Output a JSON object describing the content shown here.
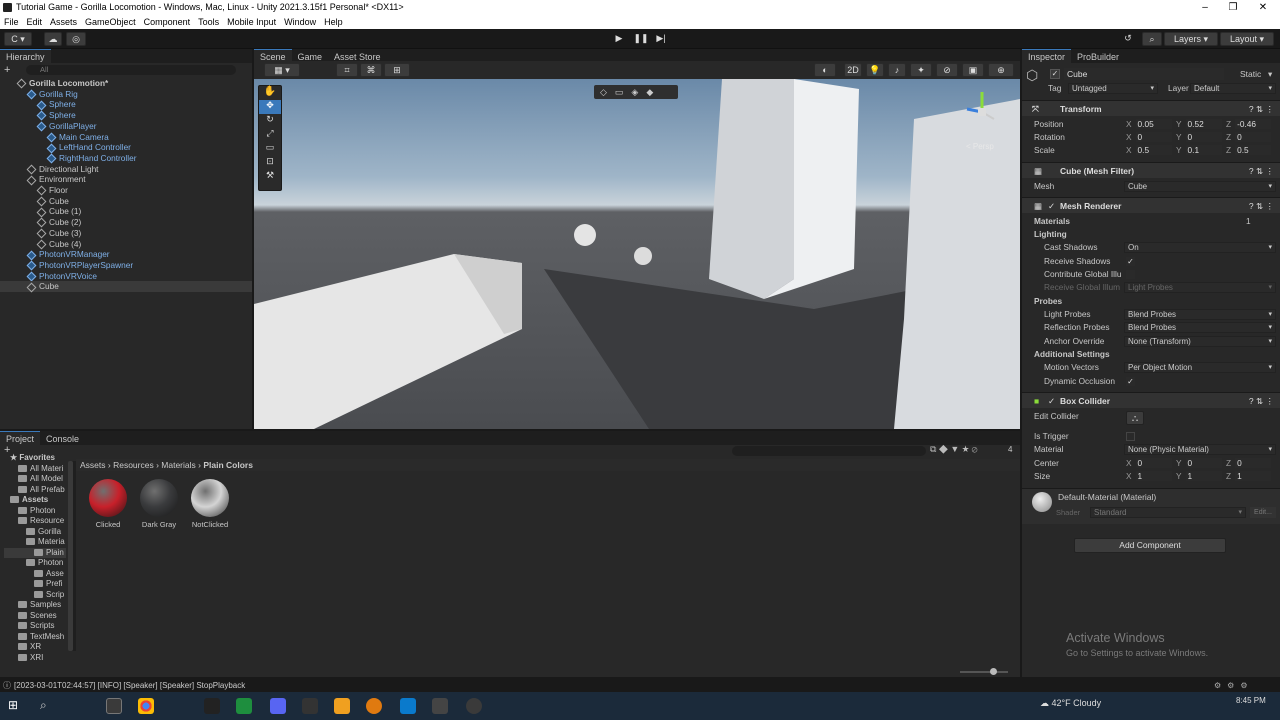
{
  "window": {
    "title": "Tutorial Game - Gorilla Locomotion - Windows, Mac, Linux - Unity 2021.3.15f1 Personal* <DX11>"
  },
  "menu": [
    "File",
    "Edit",
    "Assets",
    "GameObject",
    "Component",
    "Tools",
    "Mobile Input",
    "Window",
    "Help"
  ],
  "toolbar": {
    "layers": "Layers",
    "layout": "Layout",
    "account_initial": "C"
  },
  "hierarchy": {
    "tab": "Hierarchy",
    "search_placeholder": "All",
    "items": [
      {
        "label": "Gorilla Locomotion*",
        "indent": 0,
        "style": "scene"
      },
      {
        "label": "Gorilla Rig",
        "indent": 1,
        "style": "blue"
      },
      {
        "label": "Sphere",
        "indent": 2,
        "style": "blue"
      },
      {
        "label": "Sphere",
        "indent": 2,
        "style": "blue"
      },
      {
        "label": "GorillaPlayer",
        "indent": 2,
        "style": "blue"
      },
      {
        "label": "Main Camera",
        "indent": 3,
        "style": "blue"
      },
      {
        "label": "LeftHand Controller",
        "indent": 3,
        "style": "blue"
      },
      {
        "label": "RightHand Controller",
        "indent": 3,
        "style": "blue"
      },
      {
        "label": "Directional Light",
        "indent": 1,
        "style": "normal"
      },
      {
        "label": "Environment",
        "indent": 1,
        "style": "normal"
      },
      {
        "label": "Floor",
        "indent": 2,
        "style": "normal"
      },
      {
        "label": "Cube",
        "indent": 2,
        "style": "normal"
      },
      {
        "label": "Cube (1)",
        "indent": 2,
        "style": "normal"
      },
      {
        "label": "Cube (2)",
        "indent": 2,
        "style": "normal"
      },
      {
        "label": "Cube (3)",
        "indent": 2,
        "style": "normal"
      },
      {
        "label": "Cube (4)",
        "indent": 2,
        "style": "normal"
      },
      {
        "label": "PhotonVRManager",
        "indent": 1,
        "style": "blue"
      },
      {
        "label": "PhotonVRPlayerSpawner",
        "indent": 1,
        "style": "blue"
      },
      {
        "label": "PhotonVRVoice",
        "indent": 1,
        "style": "blue"
      },
      {
        "label": "Cube",
        "indent": 1,
        "style": "selected"
      }
    ]
  },
  "scene": {
    "tabs": [
      "Scene",
      "Game",
      "Asset Store"
    ],
    "mode_2d": "2D",
    "persp": "< Persp"
  },
  "inspector": {
    "tabs": [
      "Inspector",
      "ProBuilder"
    ],
    "object_name": "Cube",
    "static": "Static",
    "tag_label": "Tag",
    "tag": "Untagged",
    "layer_label": "Layer",
    "layer": "Default",
    "transform": {
      "title": "Transform",
      "position_label": "Position",
      "position": [
        "0.05",
        "0.52",
        "-0.46"
      ],
      "rotation_label": "Rotation",
      "rotation": [
        "0",
        "0",
        "0"
      ],
      "scale_label": "Scale",
      "scale": [
        "0.5",
        "0.1",
        "0.5"
      ]
    },
    "mesh_filter": {
      "title": "Cube (Mesh Filter)",
      "mesh_label": "Mesh",
      "mesh": "Cube"
    },
    "mesh_renderer": {
      "title": "Mesh Renderer",
      "materials_label": "Materials",
      "materials_count": "1",
      "lighting": "Lighting",
      "cast_shadows_label": "Cast Shadows",
      "cast_shadows": "On",
      "receive_shadows_label": "Receive Shadows",
      "contribute_gi_label": "Contribute Global Illu",
      "receive_gi_label": "Receive Global Illum",
      "receive_gi": "Light Probes",
      "probes": "Probes",
      "light_probes_label": "Light Probes",
      "light_probes": "Blend Probes",
      "reflection_probes_label": "Reflection Probes",
      "reflection_probes": "Blend Probes",
      "anchor_override_label": "Anchor Override",
      "anchor_override": "None (Transform)",
      "additional": "Additional Settings",
      "motion_vectors_label": "Motion Vectors",
      "motion_vectors": "Per Object Motion",
      "dynamic_occlusion_label": "Dynamic Occlusion"
    },
    "box_collider": {
      "title": "Box Collider",
      "edit_collider": "Edit Collider",
      "is_trigger": "Is Trigger",
      "material_label": "Material",
      "material": "None (Physic Material)",
      "center_label": "Center",
      "center": [
        "0",
        "0",
        "0"
      ],
      "size_label": "Size",
      "size": [
        "1",
        "1",
        "1"
      ]
    },
    "material": {
      "name": "Default-Material (Material)",
      "shader_label": "Shader",
      "shader": "Standard",
      "edit": "Edit..."
    },
    "add_component": "Add Component"
  },
  "project": {
    "tabs": [
      "Project",
      "Console"
    ],
    "breadcrumb": [
      "Assets",
      "Resources",
      "Materials",
      "Plain Colors"
    ],
    "tree": [
      {
        "label": "Favorites",
        "indent": 0,
        "bold": true
      },
      {
        "label": "All Materi",
        "indent": 1
      },
      {
        "label": "All Model",
        "indent": 1
      },
      {
        "label": "All Prefab",
        "indent": 1
      },
      {
        "label": "Assets",
        "indent": 0,
        "bold": true
      },
      {
        "label": "Photon",
        "indent": 1
      },
      {
        "label": "Resource",
        "indent": 1
      },
      {
        "label": "Gorilla",
        "indent": 2
      },
      {
        "label": "Materia",
        "indent": 2
      },
      {
        "label": "Plain",
        "indent": 3
      },
      {
        "label": "Photon",
        "indent": 2
      },
      {
        "label": "Asse",
        "indent": 3
      },
      {
        "label": "Prefi",
        "indent": 3
      },
      {
        "label": "Scrip",
        "indent": 3
      },
      {
        "label": "Samples",
        "indent": 1
      },
      {
        "label": "Scenes",
        "indent": 1
      },
      {
        "label": "Scripts",
        "indent": 1
      },
      {
        "label": "TextMesh",
        "indent": 1
      },
      {
        "label": "XR",
        "indent": 1
      },
      {
        "label": "XRI",
        "indent": 1
      }
    ],
    "assets": [
      {
        "name": "Clicked",
        "color": "#c8202a"
      },
      {
        "name": "Dark Gray",
        "color": "#3a3b3d"
      },
      {
        "name": "NotClicked",
        "color": "#d4d4d4"
      }
    ],
    "count": "4"
  },
  "status": {
    "message": "[2023-03-01T02:44:57] [INFO] [Speaker] [Speaker] StopPlayback"
  },
  "watermark": {
    "title": "Activate Windows",
    "subtitle": "Go to Settings to activate Windows."
  },
  "taskbar": {
    "weather": "42°F  Cloudy",
    "time": "8:45 PM"
  }
}
